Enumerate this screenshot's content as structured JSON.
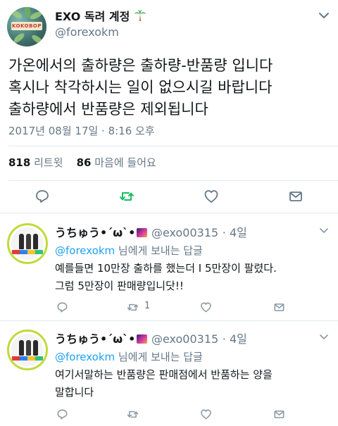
{
  "main": {
    "display_name": "EXO 독려 계정",
    "handle": "@forexokm",
    "avatar_text": "KOKOBOP",
    "lines": [
      "가온에서의 출하량은 출하량-반품량 입니다",
      "혹시나 착각하시는 일이 없으시길 바랍니다",
      "출하량에서 반품량은 제외됩니다"
    ],
    "timestamp": "2017년 08월 17일 · 8:16 오후",
    "retweet_count": "818",
    "retweet_label": "리트윗",
    "like_count": "86",
    "like_label": "마음에 들어요"
  },
  "icons": {
    "reply": "reply-icon",
    "retweet": "retweet-icon",
    "like": "heart-icon",
    "message": "envelope-icon",
    "more": "chevron-down-icon"
  },
  "colors": {
    "retweet_active": "#17bf63",
    "mention": "#1da1f2",
    "secondary": "#657786"
  },
  "replies": [
    {
      "name": "うちゅう•´ω`•",
      "handle": "@exo00315",
      "time": "· 4일",
      "reply_to_mention": "@forexokm",
      "reply_to_suffix": " 님에게 보내는 답글",
      "lines": [
        "예를들면 10만장 출하를 했는더 I  5만장이 팔렸다.",
        "그럼 5만장이 판매량입니닷!!"
      ],
      "retweet_count": "1"
    },
    {
      "name": "うちゅう•´ω`•",
      "handle": "@exo00315",
      "time": "· 4일",
      "reply_to_mention": "@forexokm",
      "reply_to_suffix": " 님에게 보내는 답글",
      "lines": [
        "여기서말하는 반품량은 판매점에서 반품하는 양을",
        "말합니다"
      ],
      "retweet_count": ""
    }
  ]
}
